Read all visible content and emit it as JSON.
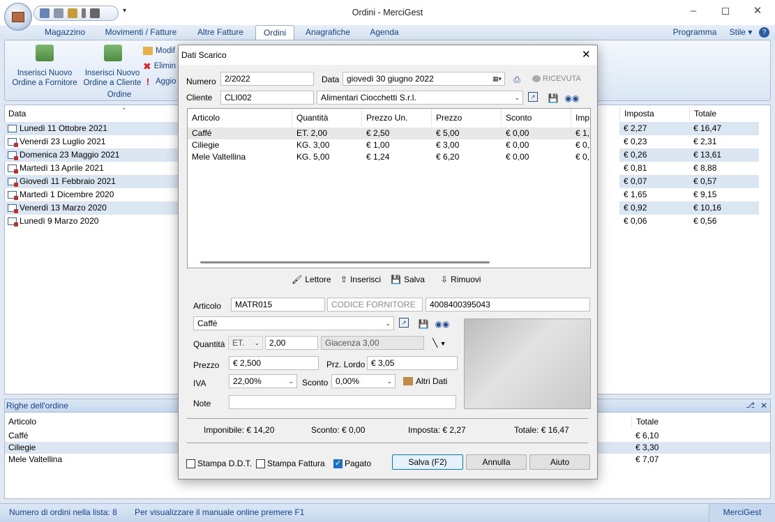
{
  "window": {
    "title": "Ordini - MerciGest"
  },
  "tabs": [
    "Magazzino",
    "Movimenti / Fatture",
    "Altre Fatture",
    "Ordini",
    "Anagrafiche",
    "Agenda"
  ],
  "right_menu": {
    "programma": "Programma",
    "stile": "Stile"
  },
  "ribbon": {
    "btn_fornitore": "Inserisci Nuovo Ordine a Fornitore",
    "btn_cliente": "Inserisci Nuovo Ordine a Cliente",
    "btn_modifica": "Modif",
    "btn_elimina": "Elimin",
    "btn_aggiorna": "Aggio",
    "group_label": "Ordine"
  },
  "orders_list": {
    "col_data": "Data",
    "col_imposta": "Imposta",
    "col_totale": "Totale",
    "rows": [
      {
        "data": "Lunedì 11 Ottobre 2021",
        "imposta": "€ 2,27",
        "totale": "€ 16,47"
      },
      {
        "data": "Venerdì 23 Luglio 2021",
        "imposta": "€ 0,23",
        "totale": "€ 2,31"
      },
      {
        "data": "Domenica 23 Maggio 2021",
        "imposta": "€ 0,26",
        "totale": "€ 13,61"
      },
      {
        "data": "Martedì 13 Aprile 2021",
        "imposta": "€ 0,81",
        "totale": "€ 8,88"
      },
      {
        "data": "Giovedì 11 Febbraio 2021",
        "imposta": "€ 0,07",
        "totale": "€ 0,57"
      },
      {
        "data": "Martedì  1 Dicembre 2020",
        "imposta": "€ 1,65",
        "totale": "€ 9,15"
      },
      {
        "data": "Venerdì 13 Marzo 2020",
        "imposta": "€ 0,92",
        "totale": "€ 10,16"
      },
      {
        "data": "Lunedì  9 Marzo 2020",
        "imposta": "€ 0,06",
        "totale": "€ 0,56"
      }
    ]
  },
  "order_lines": {
    "title": "Righe dell'ordine",
    "col_articolo": "Articolo",
    "col_totale": "Totale",
    "rows": [
      {
        "articolo": "Caffé",
        "totale": "€ 6,10"
      },
      {
        "articolo": "Ciliegie",
        "totale": "€ 3,30"
      },
      {
        "articolo": "Mele Valtellina",
        "totale": "€ 7,07"
      }
    ]
  },
  "status": {
    "count": "Numero di ordini nella lista: 8",
    "hint": "Per visualizzare il manuale online premere F1",
    "app": "MerciGest"
  },
  "dialog": {
    "title": "Dati Scarico",
    "numero_label": "Numero",
    "numero": "2/2022",
    "data_label": "Data",
    "data_value": "giovedì   30    giugno    2022",
    "ricevuta": "RICEVUTA",
    "cliente_label": "Cliente",
    "cliente_code": "CLI002",
    "cliente_name": "Alimentari Ciocchetti S.r.l.",
    "grid_headers": [
      "Articolo",
      "Quantità",
      "Prezzo Un.",
      "Prezzo",
      "Sconto",
      "Imp"
    ],
    "grid_rows": [
      [
        "Caffé",
        "ET. 2,00",
        "€ 2,50",
        "€ 5,00",
        "€ 0,00",
        "€ 1,"
      ],
      [
        "Ciliegie",
        "KG. 3,00",
        "€ 1,00",
        "€ 3,00",
        "€ 0,00",
        "€ 0,"
      ],
      [
        "Mele Valtellina",
        "KG. 5,00",
        "€ 1,24",
        "€ 6,20",
        "€ 0,00",
        "€ 0,"
      ]
    ],
    "btn_lettore": "Lettore",
    "btn_inserisci": "Inserisci",
    "btn_salva_row": "Salva",
    "btn_rimuovi": "Rimuovi",
    "articolo_label": "Articolo",
    "articolo_code": "MATR015",
    "codice_fornitore_placeholder": "CODICE FORNITORE",
    "barcode": "4008400395043",
    "articolo_name": "Caffé",
    "quantita_label": "Quantità",
    "unit": "ET.",
    "quantita": "2,00",
    "giacenza": "Giacenza 3,00",
    "prezzo_label": "Prezzo",
    "prezzo": "€ 2,500",
    "prz_lordo_label": "Prz. Lordo",
    "prz_lordo": "€ 3,05",
    "iva_label": "IVA",
    "iva": "22,00%",
    "sconto_label": "Sconto",
    "sconto": "0,00%",
    "altri_dati": "Altri Dati",
    "note_label": "Note",
    "note": "",
    "imponibile": "Imponibile: € 14,20",
    "sconto_tot": "Sconto: € 0,00",
    "imposta_tot": "Imposta: € 2,27",
    "totale_tot": "Totale: € 16,47",
    "stampa_ddt": "Stampa D.D.T.",
    "stampa_fattura": "Stampa Fattura",
    "pagato": "Pagato",
    "pagato_checked": true,
    "btn_salva": "Salva (F2)",
    "btn_annulla": "Annulla",
    "btn_aiuto": "Aiuto"
  }
}
